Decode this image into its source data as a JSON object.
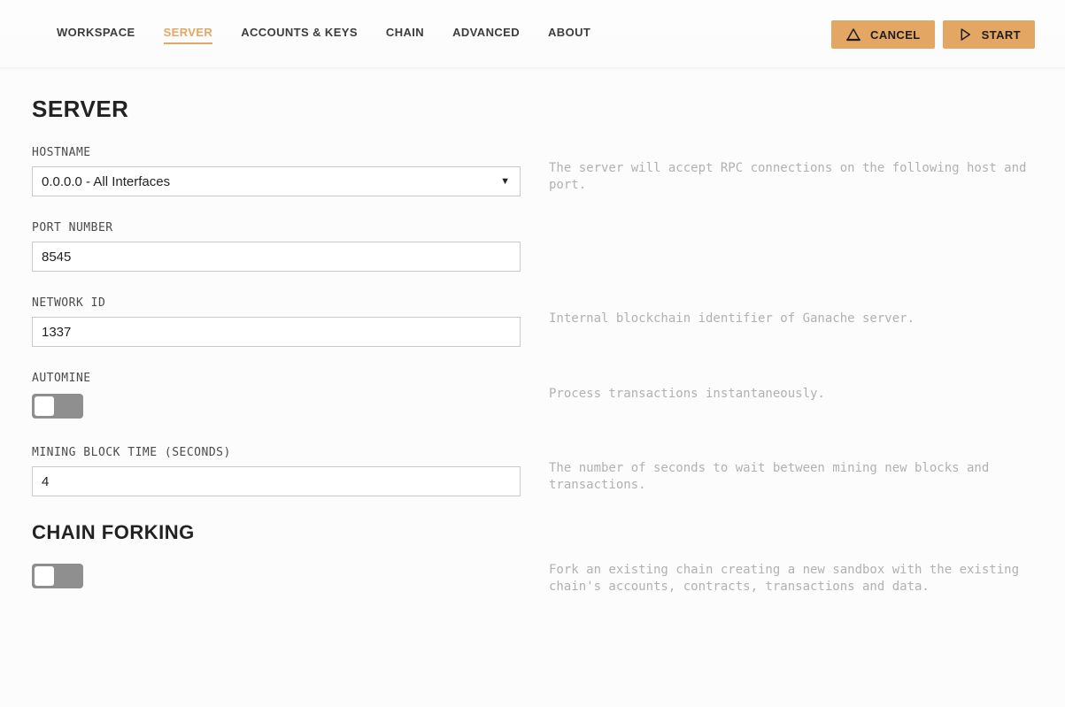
{
  "tabs": {
    "workspace": "WORKSPACE",
    "server": "SERVER",
    "accounts": "ACCOUNTS & KEYS",
    "chain": "CHAIN",
    "advanced": "ADVANCED",
    "about": "ABOUT"
  },
  "buttons": {
    "cancel": "CANCEL",
    "start": "START"
  },
  "sections": {
    "server_title": "SERVER",
    "forking_title": "CHAIN FORKING"
  },
  "fields": {
    "hostname": {
      "label": "HOSTNAME",
      "value": "0.0.0.0 - All Interfaces"
    },
    "port": {
      "label": "PORT NUMBER",
      "value": "8545"
    },
    "network_id": {
      "label": "NETWORK ID",
      "value": "1337"
    },
    "automine": {
      "label": "AUTOMINE",
      "value": false
    },
    "block_time": {
      "label": "MINING BLOCK TIME (SECONDS)",
      "value": "4"
    },
    "forking": {
      "value": false
    }
  },
  "help": {
    "hostname": "The server will accept RPC connections on the following host and port.",
    "network_id": "Internal blockchain identifier of Ganache server.",
    "automine": "Process transactions instantaneously.",
    "block_time": "The number of seconds to wait between mining new blocks and transactions.",
    "forking": "Fork an existing chain creating a new sandbox with the existing chain's accounts, contracts, transactions and data."
  }
}
